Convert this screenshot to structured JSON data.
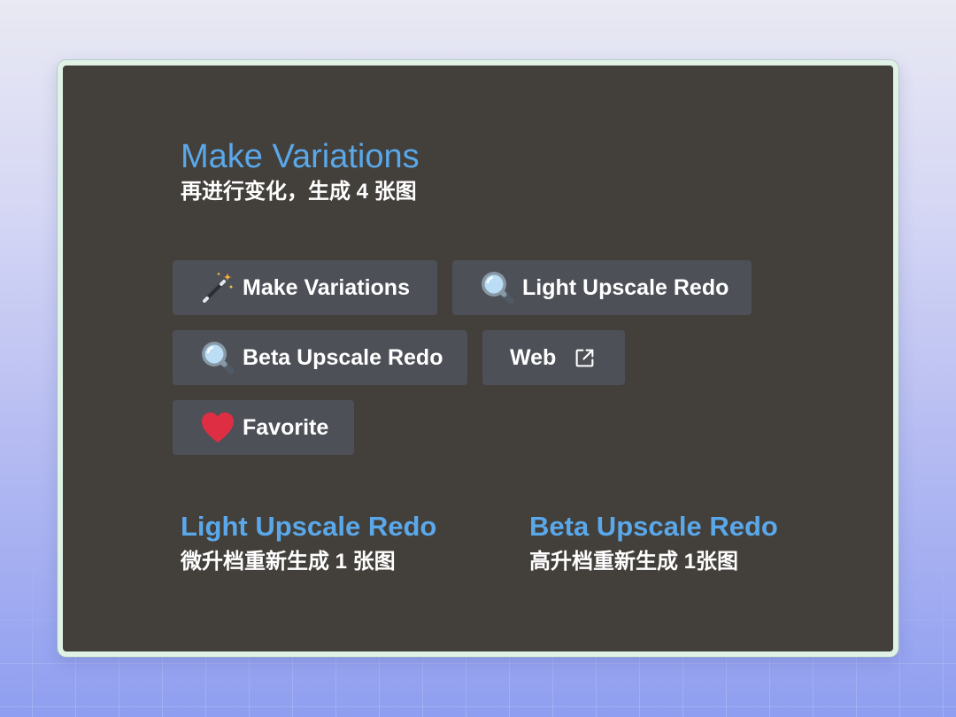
{
  "header": {
    "title": "Make Variations",
    "subtitle": "再进行变化，生成 4 张图"
  },
  "buttons": [
    {
      "label": "Make Variations",
      "icon": "magic-wand-icon"
    },
    {
      "label": "Light Upscale Redo",
      "icon": "magnifying-glass-icon"
    },
    {
      "label": "Beta Upscale Redo",
      "icon": "magnifying-glass-icon"
    },
    {
      "label": "Web",
      "icon": "external-link-icon"
    },
    {
      "label": "Favorite",
      "icon": "heart-icon"
    }
  ],
  "notes": [
    {
      "title": "Light Upscale Redo",
      "description": "微升档重新生成 1 张图"
    },
    {
      "title": "Beta Upscale Redo",
      "description": "高升档重新生成 1张图"
    }
  ],
  "colors": {
    "accent": "#5aa8ea",
    "card_background": "#433f3a",
    "card_border": "#dff2e5",
    "button_background": "#4e5058",
    "text": "#ffffff",
    "heart": "#dd2e44"
  }
}
